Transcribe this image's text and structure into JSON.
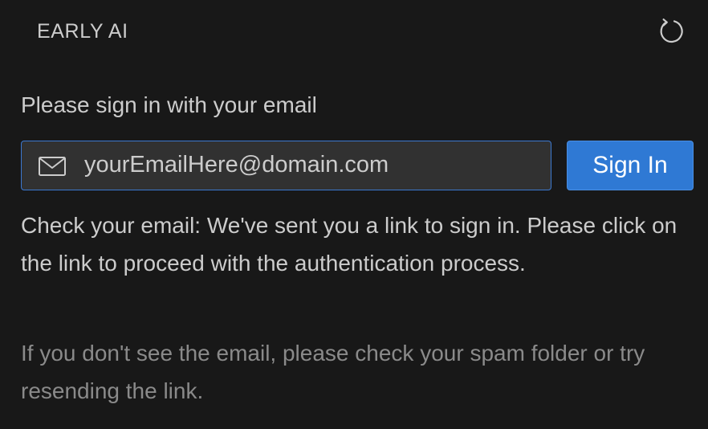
{
  "header": {
    "title": "EARLY AI",
    "refresh_icon": "refresh-icon"
  },
  "signin": {
    "prompt": "Please sign in with your email",
    "email_value": "yourEmailHere@domain.com",
    "mail_icon": "mail-icon",
    "button_label": "Sign In"
  },
  "status": {
    "message": "Check your email: We've sent you a link to sign in. Please click on the link to proceed with the authentication process.",
    "hint": "If you don't see the email, please check your spam folder or try resending the link."
  },
  "colors": {
    "background": "#181818",
    "accent": "#2f79d4",
    "input_background": "#313131",
    "text": "#cccccc",
    "muted_text": "#8a8a8a"
  }
}
